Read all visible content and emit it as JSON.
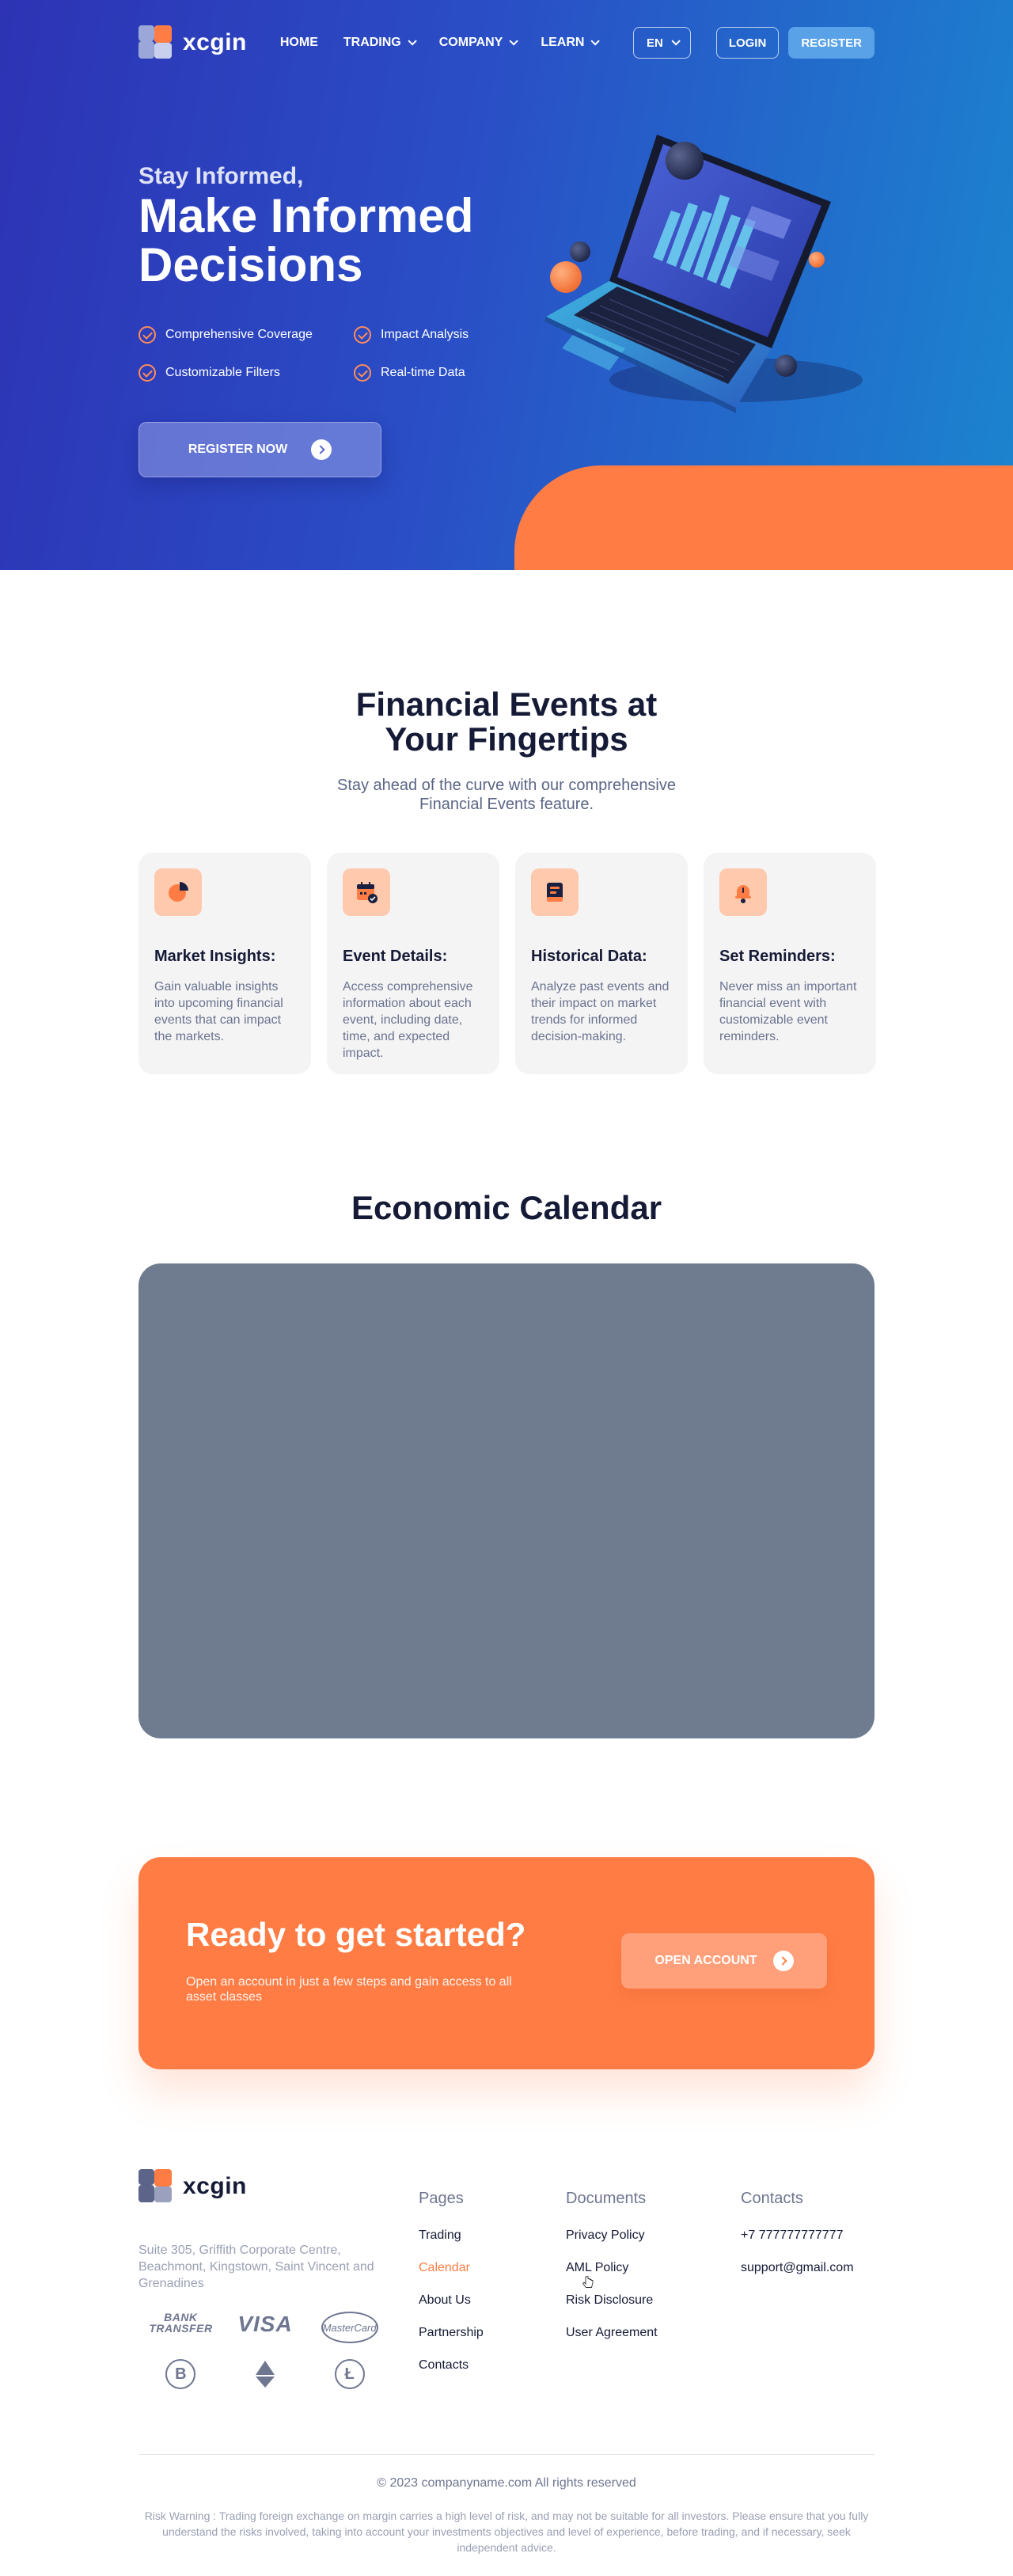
{
  "brand": {
    "name": "xcgin",
    "accent": "#ff7d45",
    "hero_start": "#2d33b4",
    "hero_end": "#1b85cf"
  },
  "nav": {
    "items": [
      {
        "label": "HOME",
        "dropdown": false
      },
      {
        "label": "TRADING",
        "dropdown": true
      },
      {
        "label": "COMPANY",
        "dropdown": true
      },
      {
        "label": "LEARN",
        "dropdown": true
      }
    ],
    "language": "EN",
    "login": "LOGIN",
    "register": "REGISTER"
  },
  "hero": {
    "subtitle": "Stay Informed,",
    "title": "Make Informed Decisions",
    "features": [
      "Comprehensive Coverage",
      "Impact Analysis",
      "Customizable Filters",
      "Real-time Data"
    ],
    "cta": "REGISTER NOW"
  },
  "features_section": {
    "title": "Financial Events at Your Fingertips",
    "subtitle": "Stay ahead of the curve with our comprehensive Financial Events feature.",
    "cards": [
      {
        "icon": "pie-chart-icon",
        "title": "Market Insights:",
        "text": "Gain valuable insights into upcoming financial events that can impact the markets."
      },
      {
        "icon": "calendar-icon",
        "title": "Event Details:",
        "text": "Access comprehensive information about each event, including date, time, and expected impact."
      },
      {
        "icon": "document-icon",
        "title": "Historical Data:",
        "text": "Analyze past events and their impact on market trends for informed decision-making."
      },
      {
        "icon": "bell-icon",
        "title": "Set Reminders:",
        "text": "Never miss an important financial event with customizable event reminders."
      }
    ]
  },
  "calendar": {
    "title": "Economic Calendar"
  },
  "cta": {
    "title": "Ready to get started?",
    "text": "Open an account in just a few steps and gain access to all asset classes",
    "button": "OPEN ACCOUNT"
  },
  "footer": {
    "address": "Suite 305, Griffith Corporate Centre, Beachmont, Kingstown, Saint Vincent and Grenadines",
    "payments": {
      "bank": "BANK TRANSFER",
      "visa": "VISA",
      "mastercard": "MasterCard",
      "bitcoin": "B",
      "litecoin": "Ł"
    },
    "pages": {
      "heading": "Pages",
      "links": [
        "Trading",
        "Calendar",
        "About Us",
        "Partnership",
        "Contacts"
      ],
      "active": "Calendar"
    },
    "documents": {
      "heading": "Documents",
      "links": [
        "Privacy Policy",
        "AML Policy",
        "Risk Disclosure",
        "User Agreement"
      ]
    },
    "contacts": {
      "heading": "Contacts",
      "links": [
        "+7 777777777777",
        "support@gmail.com"
      ]
    },
    "copyright": "© 2023 companyname.com All rights reserved",
    "risk_warning": "Risk Warning : Trading foreign exchange on margin carries a high level of risk, and may not be suitable for all investors. Please ensure that you fully understand the risks involved, taking into account your investments objectives and level of experience, before trading, and if necessary, seek independent advice."
  }
}
